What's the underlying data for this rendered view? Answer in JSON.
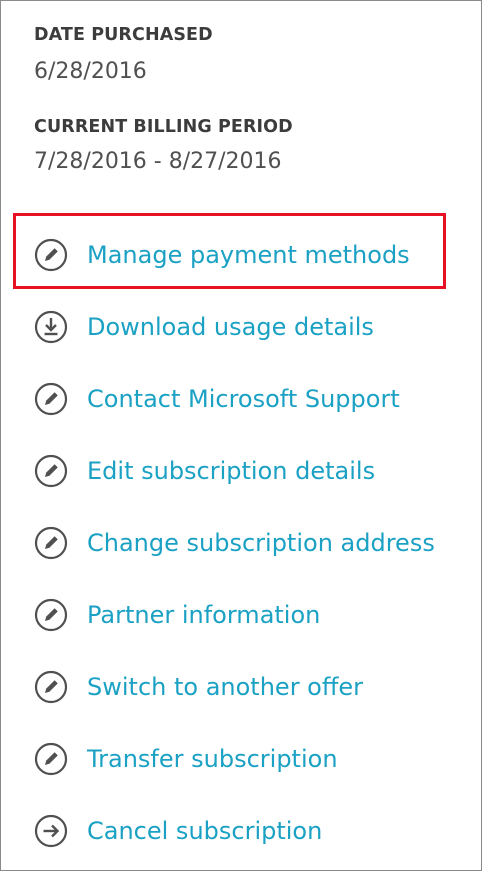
{
  "details": {
    "date_purchased_label": "DATE PURCHASED",
    "date_purchased_value": "6/28/2016",
    "billing_period_label": "CURRENT BILLING PERIOD",
    "billing_period_value": "7/28/2016 - 8/27/2016"
  },
  "actions": {
    "manage_payment": "Manage payment methods",
    "download_usage": "Download usage details",
    "contact_support": "Contact Microsoft Support",
    "edit_subscription": "Edit subscription details",
    "change_address": "Change subscription address",
    "partner_information": "Partner information",
    "switch_offer": "Switch to another offer",
    "transfer_subscription": "Transfer subscription",
    "cancel_subscription": "Cancel subscription"
  },
  "icons": {
    "manage_payment": "pencil-icon",
    "download_usage": "download-icon",
    "contact_support": "pencil-icon",
    "edit_subscription": "pencil-icon",
    "change_address": "pencil-icon",
    "partner_information": "pencil-icon",
    "switch_offer": "pencil-icon",
    "transfer_subscription": "pencil-icon",
    "cancel_subscription": "arrow-right-icon"
  },
  "colors": {
    "link": "#1ba1c4",
    "highlight": "#e81123",
    "label": "#3c3c3c",
    "value": "#505050",
    "icon": "#505050"
  }
}
